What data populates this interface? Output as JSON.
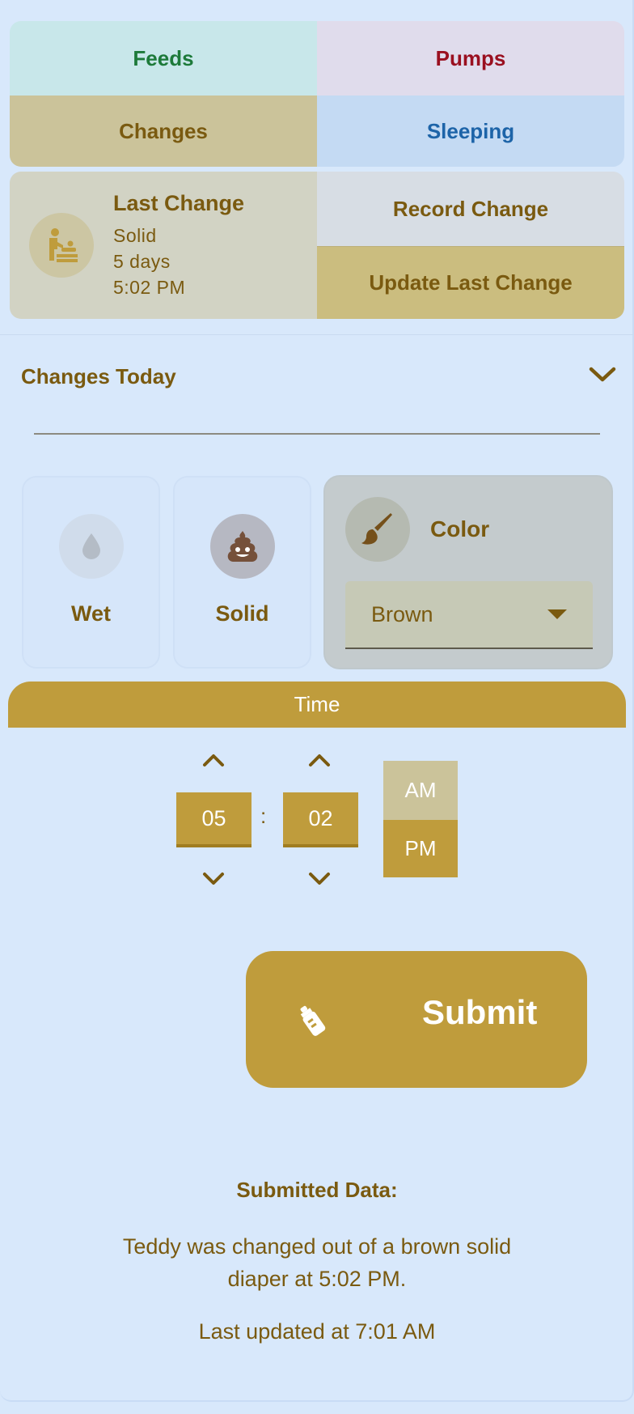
{
  "nav": {
    "tabs": [
      {
        "label": "Feeds"
      },
      {
        "label": "Pumps"
      },
      {
        "label": "Changes"
      },
      {
        "label": "Sleeping"
      }
    ]
  },
  "last_change": {
    "title": "Last Change",
    "type": "Solid",
    "ago": "5 days",
    "time": "5:02 PM",
    "icon": "baby-changing-icon",
    "record_label": "Record Change",
    "update_label": "Update Last Change"
  },
  "changes_today": {
    "label": "Changes Today",
    "icon": "chevron-down-icon"
  },
  "change_types": {
    "wet": {
      "label": "Wet",
      "icon": "droplet-icon"
    },
    "solid": {
      "label": "Solid",
      "icon": "poop-icon"
    },
    "color": {
      "label": "Color",
      "icon": "paintbrush-icon",
      "selected": "Brown"
    }
  },
  "time": {
    "label": "Time",
    "hour": "05",
    "minute": "02",
    "separator": ":",
    "am_label": "AM",
    "pm_label": "PM",
    "selected_period": "PM"
  },
  "submit": {
    "label": "Submit",
    "icon": "bottle-icon"
  },
  "submitted": {
    "title": "Submitted Data:",
    "message": "Teddy was changed out of a brown solid diaper at 5:02 PM.",
    "updated": "Last updated at 7:01 AM"
  },
  "colors": {
    "accent": "#bf9c3c",
    "text": "#7a5a10",
    "background": "#d8e8fb",
    "feeds": "#1d7a3a",
    "pumps": "#9a1020",
    "sleeping": "#1d64a8"
  }
}
